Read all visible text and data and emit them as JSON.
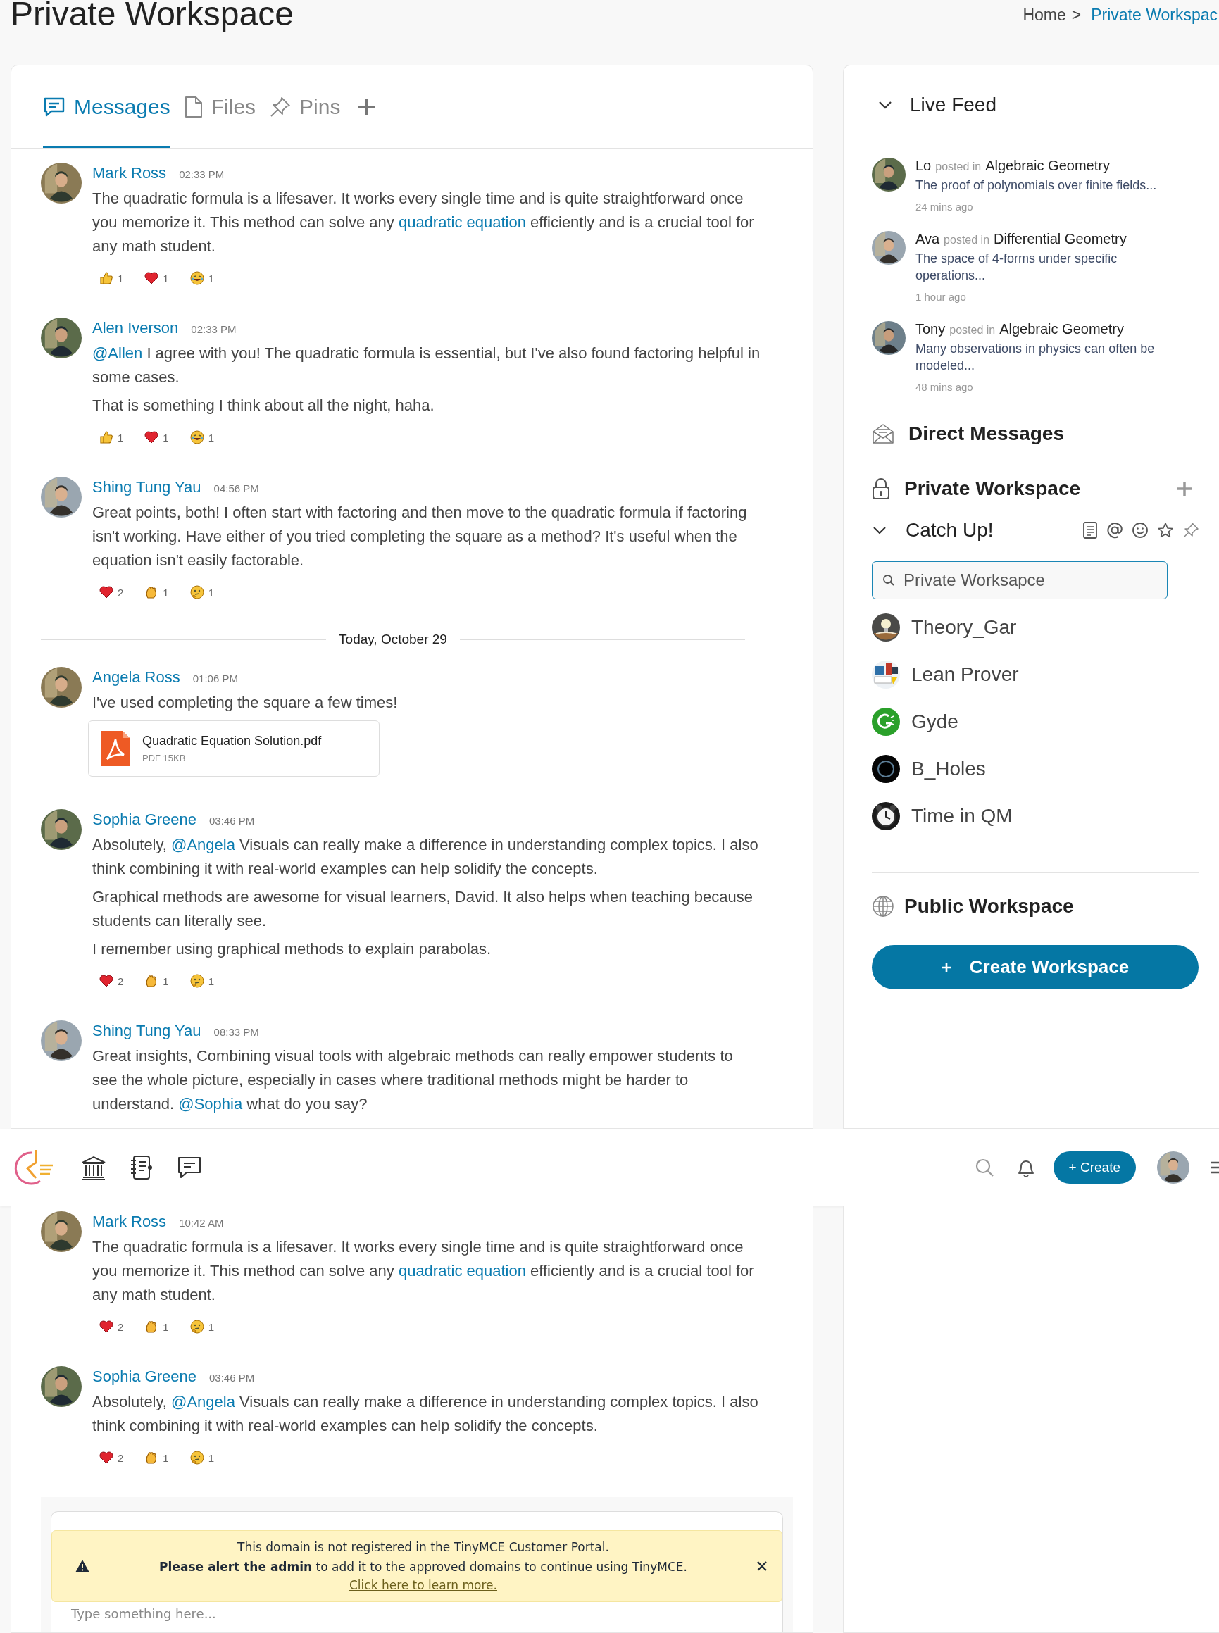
{
  "page": {
    "title": "Private Workspace",
    "breadcrumb": {
      "separator": ">",
      "items": [
        {
          "label": "Home",
          "current": false
        },
        {
          "label": "Private Workspac",
          "current": true
        }
      ]
    }
  },
  "tabs": [
    {
      "label": "Messages",
      "selected": true
    },
    {
      "label": "Files",
      "selected": false
    },
    {
      "label": "Pins",
      "selected": false
    }
  ],
  "messages": [
    {
      "kind": "message",
      "author": "Mark Ross",
      "time": "02:33 PM",
      "paragraphs": [
        [
          {
            "text": "The quadratic formula is a lifesaver. It works every single time and is quite straightforward once you memorize it. This method can solve any ",
            "link": false
          },
          {
            "text": "quadratic equation",
            "link": true
          },
          {
            "text": " efficiently and is a crucial tool for any math student.",
            "link": false
          }
        ]
      ],
      "reactions": [
        {
          "kind": "thumbs-up",
          "count": "1"
        },
        {
          "kind": "heart",
          "count": "1"
        },
        {
          "kind": "laugh",
          "count": "1"
        }
      ]
    },
    {
      "kind": "message",
      "author": "Alen Iverson",
      "time": "02:33 PM",
      "paragraphs": [
        [
          {
            "text": "@Allen",
            "link": true
          },
          {
            "text": " I agree with you! The quadratic formula is essential, but I've also found factoring helpful in some cases.",
            "link": false
          }
        ],
        [
          {
            "text": "That is something I think about all the night, haha.",
            "link": false
          }
        ]
      ],
      "reactions": [
        {
          "kind": "thumbs-up",
          "count": "1"
        },
        {
          "kind": "heart",
          "count": "1"
        },
        {
          "kind": "laugh",
          "count": "1"
        }
      ]
    },
    {
      "kind": "message",
      "author": "Shing Tung Yau",
      "time": "04:56 PM",
      "paragraphs": [
        [
          {
            "text": "Great points, both! I often start with factoring and then move to the quadratic formula if factoring isn't working. Have either of you tried completing the square as a method? It's useful when the equation isn't easily factorable.",
            "link": false
          }
        ]
      ],
      "reactions": [
        {
          "kind": "heart",
          "count": "2"
        },
        {
          "kind": "clap",
          "count": "1"
        },
        {
          "kind": "thinking",
          "count": "1"
        }
      ]
    },
    {
      "kind": "date",
      "label": "Today, October 29"
    },
    {
      "kind": "message",
      "author": "Angela Ross",
      "time": "01:06 PM",
      "paragraphs": [
        [
          {
            "text": "I've used completing the square a few times!",
            "link": false
          }
        ]
      ],
      "attachment": {
        "name": "Quadratic Equation Solution.pdf",
        "meta": "PDF 15KB"
      }
    },
    {
      "kind": "message",
      "author": "Sophia Greene",
      "time": "03:46 PM",
      "paragraphs": [
        [
          {
            "text": "Absolutely, ",
            "link": false
          },
          {
            "text": "@Angela",
            "link": true
          },
          {
            "text": " Visuals can really make a difference in understanding complex topics. I also think combining it with real-world examples can help solidify the concepts.",
            "link": false
          }
        ],
        [
          {
            "text": "Graphical methods are awesome for visual learners, David. It also helps when teaching because students can literally see.",
            "link": false
          }
        ],
        [
          {
            "text": "I remember using graphical methods to explain parabolas.",
            "link": false
          }
        ]
      ],
      "reactions": [
        {
          "kind": "heart",
          "count": "2"
        },
        {
          "kind": "clap",
          "count": "1"
        },
        {
          "kind": "thinking",
          "count": "1"
        }
      ]
    },
    {
      "kind": "message",
      "author": "Shing Tung Yau",
      "time": "08:33 PM",
      "paragraphs": [
        [
          {
            "text": "Great insights, Combining visual tools with algebraic methods can really empower students to see the whole picture, especially in cases where traditional methods might be harder to understand. ",
            "link": false
          },
          {
            "text": "@Sophia",
            "link": true
          },
          {
            "text": " what do you say?",
            "link": false
          }
        ]
      ]
    }
  ],
  "navbar": {
    "create_label": "+ Create"
  },
  "more_messages": [
    {
      "kind": "message",
      "author": "Mark Ross",
      "time": "10:42 AM",
      "paragraphs": [
        [
          {
            "text": "The quadratic formula is a lifesaver. It works every single time and is quite straightforward once you memorize it. This method can solve any ",
            "link": false
          },
          {
            "text": "quadratic equation",
            "link": true
          },
          {
            "text": " efficiently and is a crucial tool for any math student.",
            "link": false
          }
        ]
      ],
      "reactions": [
        {
          "kind": "heart",
          "count": "2"
        },
        {
          "kind": "clap",
          "count": "1"
        },
        {
          "kind": "thinking",
          "count": "1"
        }
      ]
    },
    {
      "kind": "message",
      "author": "Sophia Greene",
      "time": "03:46 PM",
      "paragraphs": [
        [
          {
            "text": "Absolutely, ",
            "link": false
          },
          {
            "text": "@Angela",
            "link": true
          },
          {
            "text": " Visuals can really make a difference in understanding complex topics. I also think combining it with real-world examples can help solidify the concepts.",
            "link": false
          }
        ]
      ],
      "reactions": [
        {
          "kind": "heart",
          "count": "2"
        },
        {
          "kind": "clap",
          "count": "1"
        },
        {
          "kind": "thinking",
          "count": "1"
        }
      ]
    }
  ],
  "composer": {
    "placeholder": "Type something here...",
    "notice": {
      "line_1": "This domain is not registered in the TinyMCE Customer Portal.",
      "line_2": "**Please alert the admin** to add it to the approved domains to continue using TinyMCE.",
      "link": "Click here to learn more."
    }
  },
  "live_feed": {
    "title": "Live Feed",
    "expanded": true,
    "posts": [
      {
        "author": "Lo",
        "verb": "posted in",
        "channel": "Algebraic Geometry",
        "excerpt": "The proof of polynomials over finite fields...",
        "time": "24 mins ago"
      },
      {
        "author": "Ava",
        "verb": "posted in",
        "channel": "Differential Geometry",
        "excerpt": "The space of 4-forms under specific operations...",
        "time": "1 hour ago"
      },
      {
        "author": "Tony",
        "verb": "posted in",
        "channel": "Algebraic Geometry",
        "excerpt": "Many observations in physics can often be modeled...",
        "time": "48 mins ago"
      }
    ]
  },
  "direct_messages": {
    "title": "Direct Messages"
  },
  "private_workspace": {
    "title": "Private Workspace",
    "catch_up": {
      "title": "Catch Up!",
      "expanded": true
    },
    "search": {
      "placeholder": "Private Worksapce"
    },
    "workspaces": [
      {
        "name": "Theory_Gar"
      },
      {
        "name": "Lean Prover"
      },
      {
        "name": "Gyde"
      },
      {
        "name": "B_Holes"
      },
      {
        "name": "Time in QM"
      }
    ]
  },
  "public_workspace": {
    "title": "Public Workspace"
  },
  "create_workspace": {
    "label": "Create Workspace"
  }
}
